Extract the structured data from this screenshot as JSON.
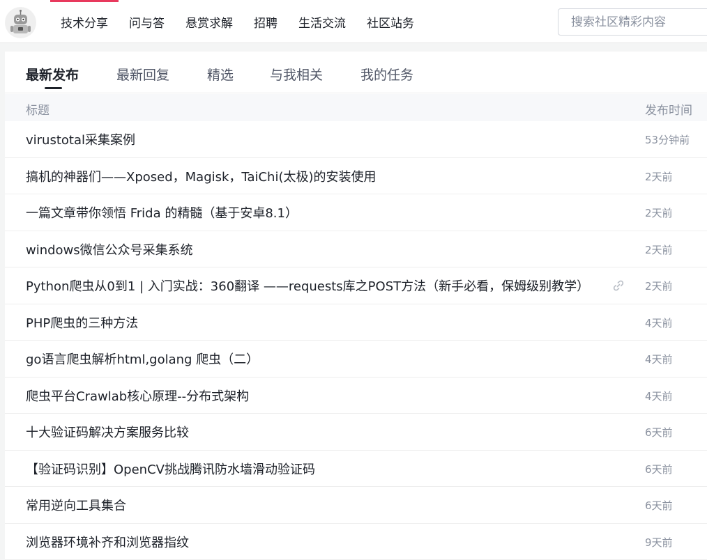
{
  "nav": {
    "items": [
      {
        "label": "技术分享",
        "active": true
      },
      {
        "label": "问与答",
        "active": false
      },
      {
        "label": "悬赏求解",
        "active": false
      },
      {
        "label": "招聘",
        "active": false
      },
      {
        "label": "生活交流",
        "active": false
      },
      {
        "label": "社区站务",
        "active": false
      }
    ],
    "search_placeholder": "搜索社区精彩内容",
    "logo_icon": "robot-avatar-icon"
  },
  "tabs": [
    {
      "label": "最新发布",
      "active": true
    },
    {
      "label": "最新回复",
      "active": false
    },
    {
      "label": "精选",
      "active": false
    },
    {
      "label": "与我相关",
      "active": false
    },
    {
      "label": "我的任务",
      "active": false
    }
  ],
  "table": {
    "col_title": "标题",
    "col_time": "发布时间",
    "rows": [
      {
        "title": "virustotal采集案例",
        "time": "53分钟前",
        "has_link": false
      },
      {
        "title": "搞机的神器们——Xposed，Magisk，TaiChi(太极)的安装使用",
        "time": "2天前",
        "has_link": false
      },
      {
        "title": "一篇文章带你领悟 Frida 的精髓（基于安卓8.1）",
        "time": "2天前",
        "has_link": false
      },
      {
        "title": "windows微信公众号采集系统",
        "time": "2天前",
        "has_link": false
      },
      {
        "title": "Python爬虫从0到1 | 入门实战：360翻译 ——requests库之POST方法（新手必看，保姆级别教学）",
        "time": "2天前",
        "has_link": true
      },
      {
        "title": "PHP爬虫的三种方法",
        "time": "4天前",
        "has_link": false
      },
      {
        "title": "go语言爬虫解析html,golang 爬虫（二）",
        "time": "4天前",
        "has_link": false
      },
      {
        "title": "爬虫平台Crawlab核心原理--分布式架构",
        "time": "4天前",
        "has_link": false
      },
      {
        "title": "十大验证码解决方案服务比较",
        "time": "6天前",
        "has_link": false
      },
      {
        "title": "【验证码识别】OpenCV挑战腾讯防水墙滑动验证码",
        "time": "6天前",
        "has_link": false
      },
      {
        "title": "常用逆向工具集合",
        "time": "6天前",
        "has_link": false
      },
      {
        "title": "浏览器环境补齐和浏览器指纹",
        "time": "9天前",
        "has_link": false
      }
    ]
  },
  "colors": {
    "accent": "#e8395d",
    "text": "#1d2129",
    "muted": "#8a919f"
  }
}
